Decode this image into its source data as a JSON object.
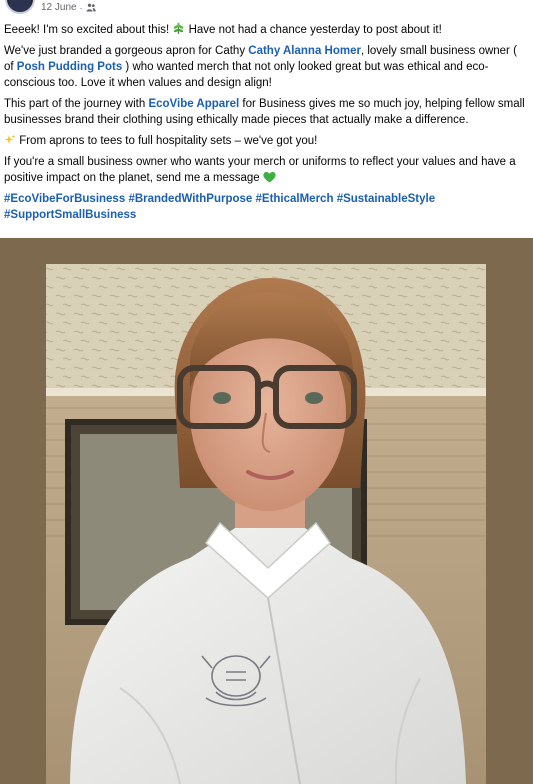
{
  "post": {
    "date": "12 June",
    "separator": "·",
    "audience_icon": "friends-icon"
  },
  "body": {
    "p1_text": "Eeeek! I'm so excited about this! ",
    "p1_emoji": "herb-emoji",
    "p1_text2": " Have not had a chance yesterday to post about it!",
    "p2_a": "We've just branded a gorgeous apron for Cathy ",
    "p2_link1": "Cathy Alanna Homer",
    "p2_b": ", lovely small business owner ( of ",
    "p2_link2": "Posh Pudding Pots",
    "p2_c": " ) who wanted merch that not only looked great but was ethical and eco-conscious too. Love it when values and design align!",
    "p3_a": "This part of the journey with ",
    "p3_link": "EcoVibe Apparel",
    "p3_b": " for Business gives me so much joy, helping fellow small businesses brand their clothing using ethically made pieces that actually make a difference.",
    "p4_emoji": "sparkles-emoji",
    "p4_text": " From aprons to tees to full hospitality sets – we've got you!",
    "p5_text": "If you're a small business owner who wants your merch or uniforms to reflect your values and have a positive impact on the planet, send me a message ",
    "p5_emoji": "green-heart-emoji",
    "hashtags": [
      "#EcoVibeForBusiness",
      "#BrandedWithPurpose",
      "#EthicalMerch",
      "#SustainableStyle",
      "#SupportSmallBusiness"
    ]
  },
  "photo": {
    "subject": "woman-in-white-chef-jacket-with-glasses"
  },
  "colors": {
    "link": "#1b5fb3",
    "meta": "#65676b",
    "heart": "#3cb043"
  }
}
